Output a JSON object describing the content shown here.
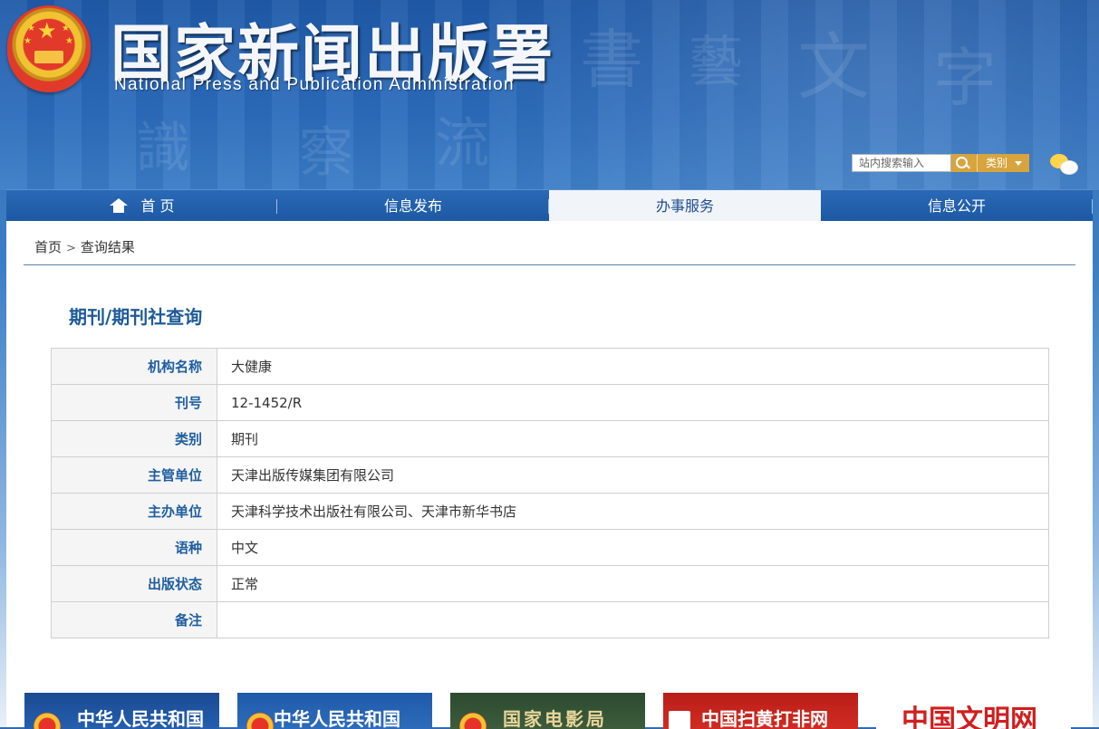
{
  "header": {
    "title_cn": "国家新闻出版署",
    "title_en": "National  Press and Publication Administration",
    "search_placeholder": "站内搜索输入",
    "category_label": "类别",
    "icons": [
      "national-emblem-icon",
      "search-icon",
      "dropdown-caret-icon",
      "wechat-icon"
    ]
  },
  "nav": {
    "items": [
      {
        "label": "首 页",
        "icon": "home-icon"
      },
      {
        "label": "信息发布"
      },
      {
        "label": "办事服务",
        "active": true
      },
      {
        "label": "信息公开"
      }
    ]
  },
  "breadcrumb": {
    "home": "首页",
    "separator": ">",
    "current": "查询结果"
  },
  "section_title": "期刊/期刊社查询",
  "table": {
    "rows": [
      {
        "label": "机构名称",
        "value": "大健康"
      },
      {
        "label": "刊号",
        "value": "12-1452/R"
      },
      {
        "label": "类别",
        "value": "期刊"
      },
      {
        "label": "主管单位",
        "value": "天津出版传媒集团有限公司"
      },
      {
        "label": "主办单位",
        "value": "天津科学技术出版社有限公司、天津市新华书店"
      },
      {
        "label": "语种",
        "value": "中文"
      },
      {
        "label": "出版状态",
        "value": "正常"
      },
      {
        "label": "备注",
        "value": ""
      }
    ]
  },
  "banners": [
    {
      "text": "中华人民共和国",
      "color": "#1d4f9a"
    },
    {
      "text": "中华人民共和国",
      "color": "#2262b0"
    },
    {
      "text": "国家电影局",
      "color": "#2f4a30"
    },
    {
      "text": "中国扫黄打非网",
      "color": "#c0221b"
    },
    {
      "text": "中国文明网",
      "color": "#ffffff"
    }
  ],
  "colors": {
    "brand_blue": "#1e5b98",
    "nav_blue": "#2a69b6",
    "accent_gold": "#d7a43d"
  }
}
